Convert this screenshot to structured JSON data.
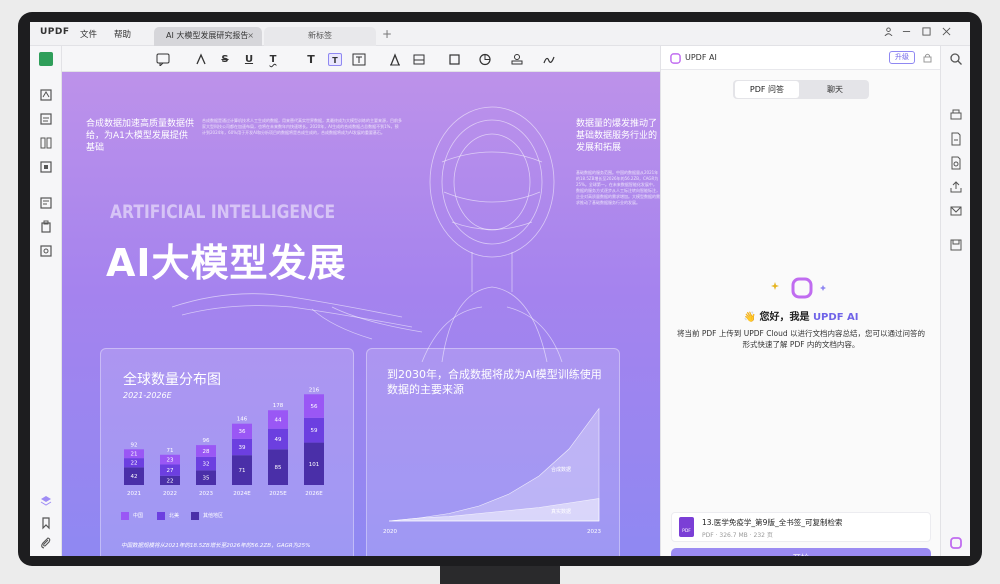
{
  "app": {
    "logo": "UPDF",
    "menus": [
      "文件",
      "帮助"
    ],
    "tabs": [
      {
        "label": "AI 大模型发展研究报告",
        "close": "×"
      },
      {
        "label": "新标签"
      }
    ],
    "new_tab": "+"
  },
  "document": {
    "left_header": "合成数据加速高质量数据供给，为A1大模型发展提供基础",
    "left_body": "合成数据是通过计算机技术人工生成的数据，用来替代真实世界数据，其最终成为大模型训练的主要来源，目前多家大型科技公司都在加速布局，也将在未来数年内快速增长。2020年，AI生成的合成数据占总数据不到1%，预计到2024年，60%用于开发AI和分析项目的数据将是合成生成的，合成数据将成为AI发展的重要基石。",
    "right_header": "数据量的爆发推动了基础数据服务行业的发展和拓展",
    "right_body": "基础数据的服务范围。中国的数据量从2021年的18.5ZB增长至2026年的56.2ZB，CAGR为25%。全球第一。在未来数据智能化发展中，数据的服务方式逐步从人工标注转向智能标注，企业对高质量数据的需求增加。大模型数据的需求推动了基础数据服务行业的发展。",
    "en_title": "ARTIFICIAL INTELLIGENCE",
    "cn_title": "AI大模型发展",
    "bar_card": {
      "title": "全球数量分布图",
      "subtitle": "2021-2026E",
      "legend": [
        "中国",
        "北美",
        "其他地区"
      ],
      "footer": "中国数据规模将从2021年的18.5ZB增长至2026年的56.2ZB，GAGR为25%",
      "colors": [
        "#9a57f5",
        "#6c3fe0",
        "#4a2fa8"
      ]
    },
    "area_card": {
      "title": "到2030年，合成数据将成为AI模型训练使用数据的主要来源",
      "series_labels": [
        "合成数据",
        "真实数据"
      ],
      "x_start": "2020",
      "x_end": "2023"
    }
  },
  "chart_data": [
    {
      "type": "bar",
      "title": "全球数量分布图",
      "subtitle": "2021-2026E",
      "categories": [
        "2021",
        "2022",
        "2023",
        "2024E",
        "2025E",
        "2026E"
      ],
      "totals": [
        "92",
        "71",
        "96",
        "146",
        "178",
        "216"
      ],
      "series": [
        {
          "name": "中国",
          "values": [
            21,
            23,
            28,
            36,
            44,
            56
          ]
        },
        {
          "name": "北美",
          "values": [
            22,
            27,
            32,
            39,
            49,
            59
          ]
        },
        {
          "name": "其他地区",
          "values": [
            42,
            22,
            35,
            71,
            85,
            101
          ]
        }
      ]
    },
    {
      "type": "area",
      "title": "到2030年，合成数据将成为AI模型训练使用数据的主要来源",
      "x": [
        "2020",
        "2023"
      ],
      "series": [
        {
          "name": "合成数据",
          "values": [
            0,
            2,
            5,
            10,
            18,
            30,
            48,
            75
          ]
        },
        {
          "name": "真实数据",
          "values": [
            0,
            2,
            3,
            5,
            7,
            9,
            12,
            15
          ]
        }
      ]
    }
  ],
  "ai_panel": {
    "title": "UPDF AI",
    "upgrade": "升级",
    "seg_tabs": [
      "PDF 问答",
      "聊天"
    ],
    "greeting_prefix": "👋 您好，我是 ",
    "greeting_brand": "UPDF AI",
    "description": "将当前 PDF 上传到 UPDF Cloud 以进行文档内容总结，您可以通过问答的形式快速了解 PDF 内的文档内容。",
    "file_name": "13.医学免疫学_第9版_全书签_可复制检索",
    "file_meta": "PDF · 326.7 MB · 232 页",
    "file_badge": "PDF",
    "start": "开始"
  }
}
